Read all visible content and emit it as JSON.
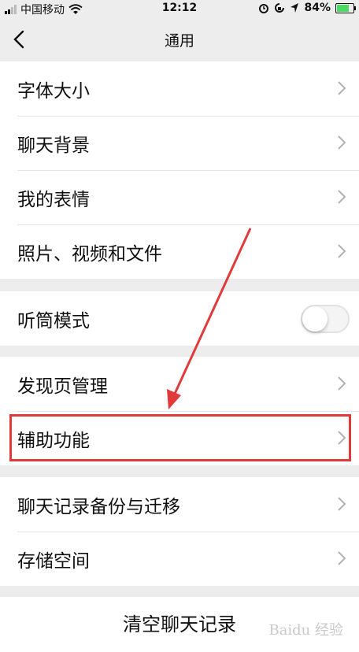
{
  "status_bar": {
    "carrier": "中国移动",
    "time": "12:12",
    "battery": "84%",
    "battery_level": 0.84,
    "icons": [
      "signal-icon",
      "wifi-icon",
      "alarm-icon",
      "lock-rotation-icon",
      "location-icon",
      "battery-icon"
    ]
  },
  "nav": {
    "title": "通用",
    "back_icon": "chevron-left-icon"
  },
  "groups": {
    "general": [
      "字体大小",
      "聊天背景",
      "我的表情",
      "照片、视频和文件"
    ],
    "earpiece": {
      "label": "听筒模式",
      "enabled": false
    },
    "discover": [
      "发现页管理",
      "辅助功能"
    ],
    "storage": [
      "聊天记录备份与迁移",
      "存储空间"
    ]
  },
  "clear_button": "清空聊天记录",
  "annotation": {
    "color": "#e03a3a"
  },
  "watermark": "Baidu 经验",
  "colors": {
    "background": "#ededed",
    "cell": "#ffffff",
    "text": "#111111",
    "chevron": "#b2b2b2"
  }
}
